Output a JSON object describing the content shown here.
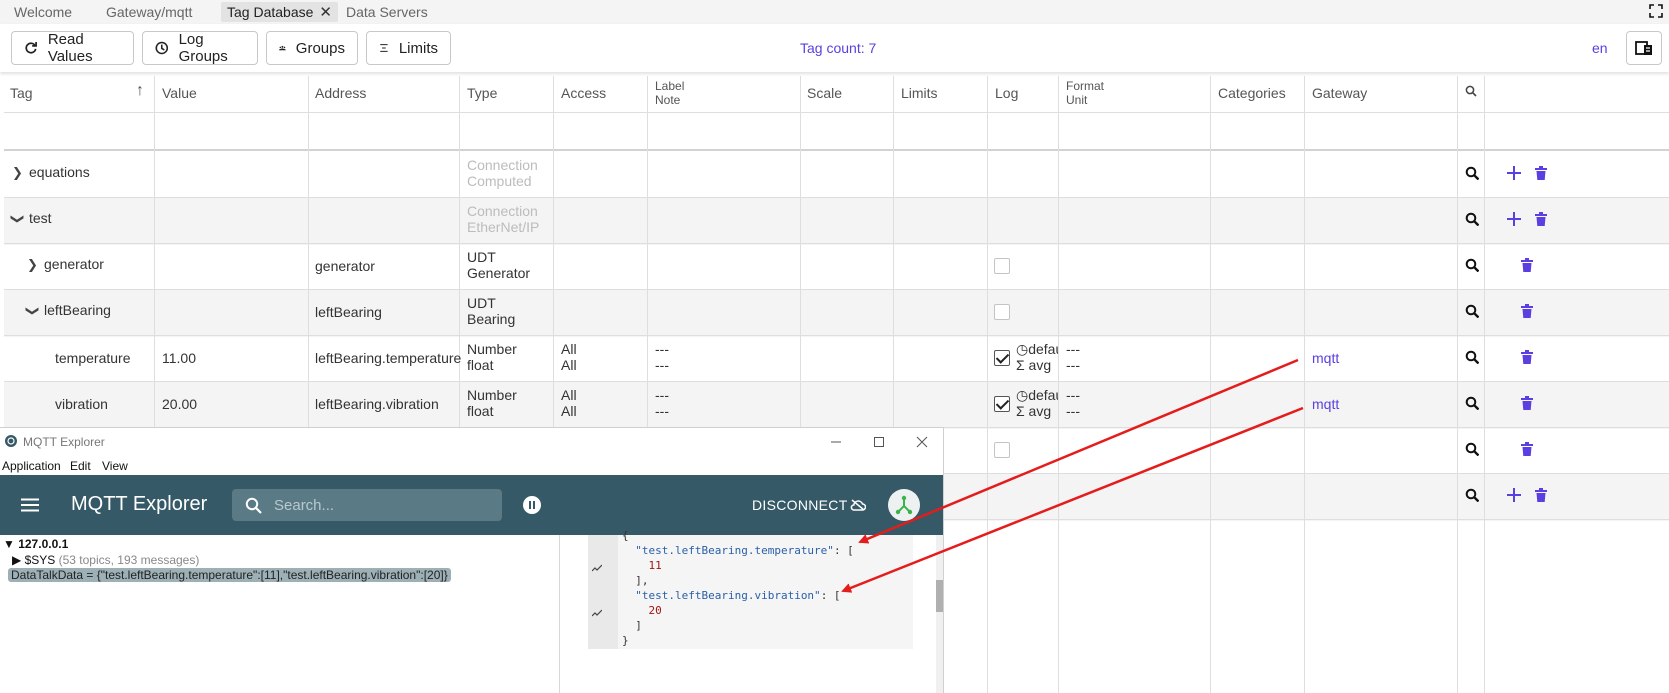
{
  "tabs": [
    {
      "label": "Welcome"
    },
    {
      "label": "Gateway/mqtt"
    },
    {
      "label": "Tag Database",
      "close": "✕"
    },
    {
      "label": "Data Servers"
    }
  ],
  "toolbar": {
    "read_values": "Read Values",
    "log_groups": "Log Groups",
    "groups": "Groups",
    "limits": "Limits",
    "tag_count": "Tag count: 7",
    "lang": "en"
  },
  "table": {
    "headers": {
      "tag": "Tag",
      "sort": "↑",
      "value": "Value",
      "address": "Address",
      "type": "Type",
      "access": "Access",
      "label1": "Label",
      "label2": "Note",
      "scale": "Scale",
      "limits": "Limits",
      "log": "Log",
      "format1": "Format",
      "format2": "Unit",
      "categories": "Categories",
      "gateway": "Gateway"
    },
    "rows": [
      {
        "tag": "equations",
        "value": "",
        "address": "",
        "type1": "Connection",
        "type2": "Computed",
        "access1": "",
        "access2": "",
        "label1": "",
        "label2": "",
        "log1": "",
        "log2": "",
        "fmt1": "",
        "fmt2": "",
        "gateway": ""
      },
      {
        "tag": "test",
        "value": "",
        "address": "",
        "type1": "Connection",
        "type2": "EtherNet/IP",
        "access1": "",
        "access2": "",
        "label1": "",
        "label2": "",
        "log1": "",
        "log2": "",
        "fmt1": "",
        "fmt2": "",
        "gateway": ""
      },
      {
        "tag": "generator",
        "value": "",
        "address": "generator",
        "type1": "UDT",
        "type2": "Generator",
        "access1": "",
        "access2": "",
        "label1": "",
        "label2": "",
        "log1": "",
        "log2": "",
        "fmt1": "",
        "fmt2": "",
        "gateway": ""
      },
      {
        "tag": "leftBearing",
        "value": "",
        "address": "leftBearing",
        "type1": "UDT",
        "type2": "Bearing",
        "access1": "",
        "access2": "",
        "label1": "",
        "label2": "",
        "log1": "",
        "log2": "",
        "fmt1": "",
        "fmt2": "",
        "gateway": ""
      },
      {
        "tag": "temperature",
        "value": "11.00",
        "address": "leftBearing.temperature",
        "type1": "Number",
        "type2": "float",
        "access1": "All",
        "access2": "All",
        "label1": "---",
        "label2": "---",
        "log1": "defau",
        "log2": "avg",
        "fmt1": "---",
        "fmt2": "---",
        "gateway": "mqtt"
      },
      {
        "tag": "vibration",
        "value": "20.00",
        "address": "leftBearing.vibration",
        "type1": "Number",
        "type2": "float",
        "access1": "All",
        "access2": "All",
        "label1": "---",
        "label2": "---",
        "log1": "defau",
        "log2": "avg",
        "fmt1": "---",
        "fmt2": "---",
        "gateway": "mqtt"
      }
    ]
  },
  "mqtt": {
    "window_title": "MQTT Explorer",
    "menu": [
      "Application",
      "Edit",
      "View"
    ],
    "brand": "MQTT Explorer",
    "search_placeholder": "Search...",
    "disconnect": "DISCONNECT",
    "host": "▼ 127.0.0.1",
    "sys_label": "▶ $SYS",
    "sys_meta": "(53 topics, 193 messages)",
    "data_line": "DataTalkData = {\"test.leftBearing.temperature\":[11],\"test.leftBearing.vibration\":[20]}",
    "code": {
      "open": "{",
      "key1": "\"test.leftBearing.temperature\"",
      "colon1": ": [",
      "val1": "11",
      "close1": "],",
      "key2": "\"test.leftBearing.vibration\"",
      "colon2": ": [",
      "val2": "20",
      "close2": "]",
      "end": "}"
    }
  },
  "colors": {
    "accent": "#5b3fe0",
    "mqtt_header": "#355966",
    "arrow": "#e51c1c"
  }
}
